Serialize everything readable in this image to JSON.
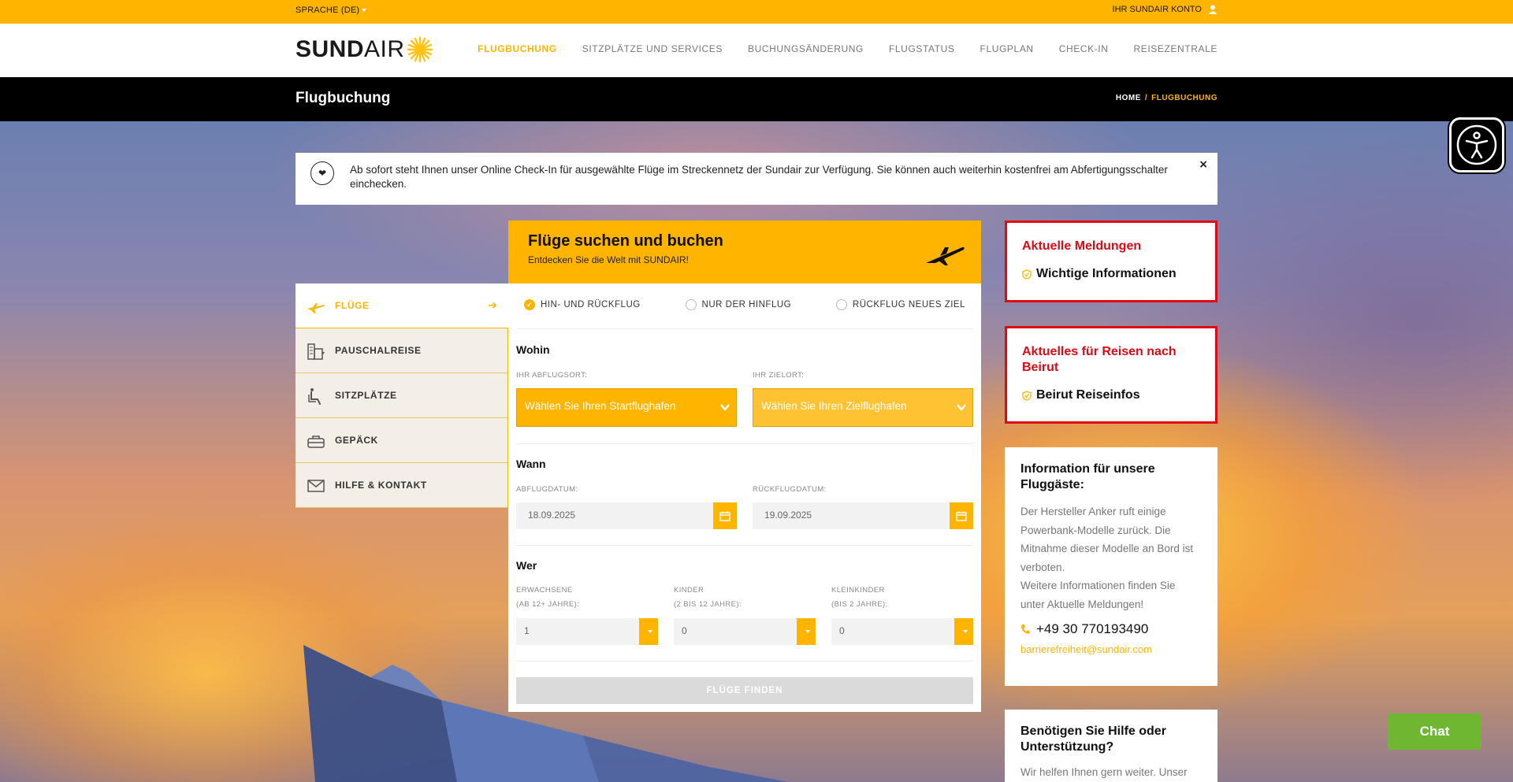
{
  "topbar": {
    "language": "SPRACHE (DE)",
    "account": "IHR SUNDAIR KONTO"
  },
  "header": {
    "logo_bold": "SUND",
    "logo_light": "AIR",
    "nav": [
      {
        "label": "FLUGBUCHUNG",
        "active": true
      },
      {
        "label": "SITZPLÄTZE UND SERVICES"
      },
      {
        "label": "BUCHUNGSÄNDERUNG"
      },
      {
        "label": "FLUGSTATUS"
      },
      {
        "label": "FLUGPLAN"
      },
      {
        "label": "CHECK-IN"
      },
      {
        "label": "REISEZENTRALE"
      }
    ]
  },
  "titlebar": {
    "title": "Flugbuchung",
    "breadcrumb_home": "HOME",
    "breadcrumb_sep": "/",
    "breadcrumb_current": "FLUGBUCHUNG"
  },
  "notice": {
    "message": "Ab sofort steht Ihnen unser Online Check-In für ausgewählte Flüge im Streckennetz der Sundair zur Verfügung. Sie können auch weiterhin kostenfrei am Abfertigungsschalter einchecken.",
    "close": "×"
  },
  "sidemenu": {
    "items": [
      {
        "label": "FLÜGE",
        "icon": "plane-icon",
        "active": true
      },
      {
        "label": "PAUSCHALREISE",
        "icon": "hotel-icon"
      },
      {
        "label": "SITZPLÄTZE",
        "icon": "seat-icon"
      },
      {
        "label": "GEPÄCK",
        "icon": "luggage-icon"
      },
      {
        "label": "HILFE & KONTAKT",
        "icon": "envelope-icon"
      }
    ]
  },
  "booking": {
    "title": "Flüge suchen und buchen",
    "subtitle": "Entdecken Sie die Welt mit SUNDAIR!",
    "trip_types": [
      {
        "label": "HIN- UND RÜCKFLUG",
        "selected": true
      },
      {
        "label": "NUR DER HINFLUG",
        "selected": false
      },
      {
        "label": "RÜCKFLUG NEUES ZIEL",
        "selected": false
      }
    ],
    "where": {
      "title": "Wohin",
      "origin_label": "IHR ABFLUGSORT:",
      "origin_value": "Wählen Sie Ihren Startflughafen",
      "dest_label": "IHR ZIELORT:",
      "dest_value": "Wählen Sie Ihren Zielflughafen"
    },
    "when": {
      "title": "Wann",
      "depart_label": "ABFLUGDATUM:",
      "depart_value": "18.09.2025",
      "return_label": "RÜCKFLUGDATUM:",
      "return_value": "19.09.2025"
    },
    "who": {
      "title": "Wer",
      "adults_label_1": "ERWACHSENE",
      "adults_label_2": "(AB 12+ JAHRE):",
      "adults_value": "1",
      "children_label_1": "KINDER",
      "children_label_2": "(2 BIS 12 JAHRE):",
      "children_value": "0",
      "infants_label_1": "KLEINKINDER",
      "infants_label_2": "(BIS 2 JAHRE):",
      "infants_value": "0"
    },
    "submit": "FLÜGE FINDEN"
  },
  "right": {
    "news": {
      "title": "Aktuelle Meldungen",
      "link": "Wichtige Informationen"
    },
    "beirut": {
      "title": "Aktuelles für Reisen nach Beirut",
      "link": "Beirut Reiseinfos"
    },
    "info": {
      "title": "Information für unsere Fluggäste:",
      "text": "Der Hersteller Anker ruft einige Powerbank-Modelle zurück. Die Mitnahme dieser Modelle an Bord ist verboten.",
      "text2": "Weitere Informationen finden Sie unter Aktuelle Meldungen!",
      "phone": "+49 30 770193490",
      "email": "barrierefreiheit@sundair.com"
    },
    "help": {
      "title": "Benötigen Sie Hilfe oder Unterstützung?",
      "text": "Wir helfen Ihnen gern weiter. Unser"
    }
  },
  "chat": "Chat",
  "colors": {
    "accent": "#ffb400",
    "alert": "#e30613",
    "chat": "#6fb730"
  }
}
